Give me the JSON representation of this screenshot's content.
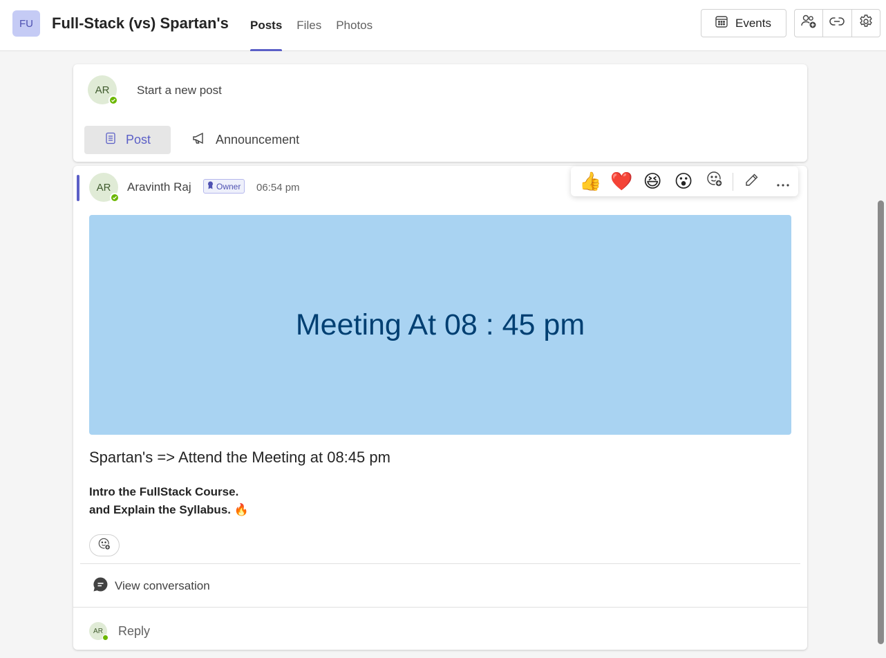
{
  "header": {
    "team_initials": "FU",
    "team_name": "Full-Stack (vs) Spartan's",
    "tabs": [
      {
        "label": "Posts",
        "active": true
      },
      {
        "label": "Files",
        "active": false
      },
      {
        "label": "Photos",
        "active": false
      }
    ],
    "events_label": "Events",
    "icons": [
      "add-member-icon",
      "link-icon",
      "settings-icon"
    ]
  },
  "new_post": {
    "avatar_initials": "AR",
    "placeholder": "Start a new post",
    "post_label": "Post",
    "announcement_label": "Announcement"
  },
  "message": {
    "avatar_initials": "AR",
    "author": "Aravinth Raj",
    "role_badge": "Owner",
    "time": "06:54 pm",
    "reactions": [
      "👍",
      "❤️",
      "😆",
      "😮"
    ],
    "banner_text": "Meeting At 08 : 45 pm",
    "subject": "Spartan's => Attend the Meeting at 08:45 pm",
    "body_line1": "Intro the FullStack Course.",
    "body_line2": "and Explain the Syllabus.",
    "body_emoji": "🔥",
    "view_conversation": "View conversation",
    "reply_avatar_initials": "AR",
    "reply_label": "Reply"
  },
  "colors": {
    "accent": "#5b5fc7",
    "banner_bg": "#a9d3f2",
    "banner_text": "#003f72",
    "presence": "#6bb700"
  }
}
